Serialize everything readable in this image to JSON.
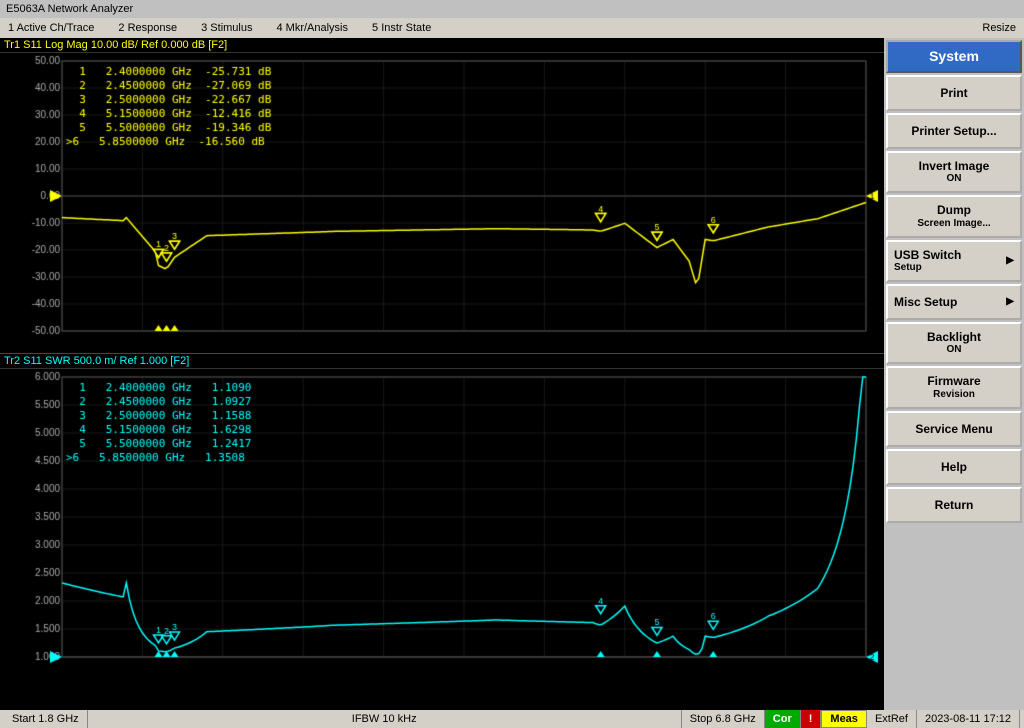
{
  "titleBar": {
    "label": "E5063A Network Analyzer"
  },
  "menuBar": {
    "items": [
      {
        "id": "active-ch",
        "label": "1 Active Ch/Trace"
      },
      {
        "id": "response",
        "label": "2 Response"
      },
      {
        "id": "stimulus",
        "label": "3 Stimulus"
      },
      {
        "id": "mkr-analysis",
        "label": "4 Mkr/Analysis"
      },
      {
        "id": "instr-state",
        "label": "5 Instr State"
      }
    ],
    "resize": "Resize"
  },
  "sidebar": {
    "title": "System",
    "buttons": [
      {
        "id": "print",
        "label": "Print",
        "hasArrow": false
      },
      {
        "id": "printer-setup",
        "label": "Printer Setup...",
        "hasArrow": false
      },
      {
        "id": "invert-image",
        "label": "Invert Image\nON",
        "hasArrow": false
      },
      {
        "id": "dump-screen",
        "label": "Dump\nScreen Image...",
        "hasArrow": false
      },
      {
        "id": "usb-switch",
        "label": "USB Switch\nSetup",
        "hasArrow": true
      },
      {
        "id": "misc-setup",
        "label": "Misc Setup",
        "hasArrow": true
      },
      {
        "id": "backlight",
        "label": "Backlight\nON",
        "hasArrow": false
      },
      {
        "id": "firmware-revision",
        "label": "Firmware\nRevision",
        "hasArrow": false
      },
      {
        "id": "service-menu",
        "label": "Service Menu",
        "hasArrow": false
      },
      {
        "id": "help",
        "label": "Help",
        "hasArrow": false
      },
      {
        "id": "return",
        "label": "Return",
        "hasArrow": false
      }
    ]
  },
  "trace1": {
    "header": "Tr1  S11  Log Mag  10.00 dB/  Ref  0.000 dB  [F2]",
    "markers": [
      {
        "num": 1,
        "freq": "2.4000000 GHz",
        "val": "-25.731 dB"
      },
      {
        "num": 2,
        "freq": "2.4500000 GHz",
        "val": "-27.069 dB"
      },
      {
        "num": 3,
        "freq": "2.5000000 GHz",
        "val": "-22.667 dB"
      },
      {
        "num": 4,
        "freq": "5.1500000 GHz",
        "val": "-12.416 dB"
      },
      {
        "num": 5,
        "freq": "5.5000000 GHz",
        "val": "-19.346 dB"
      },
      {
        "num": 6,
        "freq": "5.8500000 GHz",
        "val": "-16.560 dB"
      }
    ],
    "yMax": 50.0,
    "yMin": -50.0,
    "yRef": 0.0,
    "yScale": 10.0
  },
  "trace2": {
    "header": "Tr2  S11  SWR  500.0 m/  Ref  1.000   [F2]",
    "markers": [
      {
        "num": 1,
        "freq": "2.4000000 GHz",
        "val": "1.1090"
      },
      {
        "num": 2,
        "freq": "2.4500000 GHz",
        "val": "1.0927"
      },
      {
        "num": 3,
        "freq": "2.5000000 GHz",
        "val": "1.1588"
      },
      {
        "num": 4,
        "freq": "5.1500000 GHz",
        "val": "1.6298"
      },
      {
        "num": 5,
        "freq": "5.5000000 GHz",
        "val": "1.2417"
      },
      {
        "num": 6,
        "freq": "5.8500000 GHz",
        "val": "1.3508"
      }
    ],
    "yMax": 6.0,
    "yMin": 1.0,
    "yRef": 1.0,
    "yScale": 0.5
  },
  "statusBar": {
    "start": "Start 1.8 GHz",
    "ifbw": "IFBW 10 kHz",
    "stop": "Stop 6.8 GHz",
    "cor": "Cor",
    "exclaim": "!",
    "meas": "Meas",
    "extRef": "ExtRef",
    "time": "2023-08-11  17:12"
  }
}
